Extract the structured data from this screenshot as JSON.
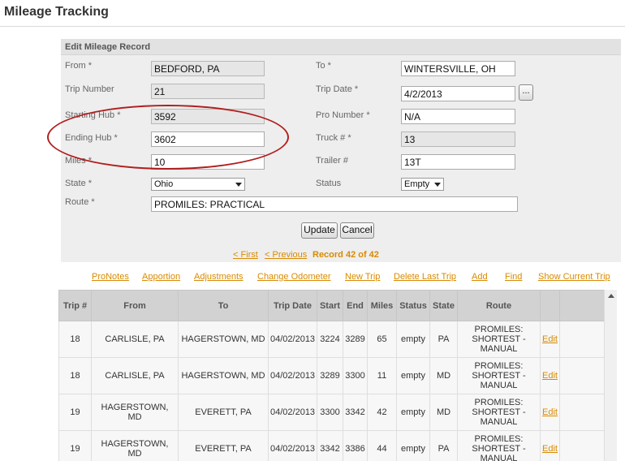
{
  "page": {
    "title": "Mileage Tracking"
  },
  "form": {
    "header": "Edit Mileage Record",
    "from": {
      "label": "From *",
      "value": "BEDFORD, PA"
    },
    "to": {
      "label": "To *",
      "value": "WINTERSVILLE, OH"
    },
    "trip_number": {
      "label": "Trip Number",
      "value": "21"
    },
    "trip_date": {
      "label": "Trip Date *",
      "value": "4/2/2013",
      "picker_label": "..."
    },
    "starting_hub": {
      "label": "Starting Hub *",
      "value": "3592"
    },
    "pro_number": {
      "label": "Pro Number *",
      "value": "N/A"
    },
    "ending_hub": {
      "label": "Ending Hub *",
      "value": "3602"
    },
    "truck": {
      "label": "Truck # *",
      "value": "13"
    },
    "miles": {
      "label": "Miles *",
      "value": "10"
    },
    "trailer": {
      "label": "Trailer #",
      "value": "13T"
    },
    "state": {
      "label": "State *",
      "value": "Ohio"
    },
    "status": {
      "label": "Status",
      "value": "Empty"
    },
    "route": {
      "label": "Route *",
      "value": "PROMILES: PRACTICAL"
    },
    "update_label": "Update",
    "cancel_label": "Cancel"
  },
  "pager": {
    "first": "< First",
    "previous": "< Previous",
    "record": "Record 42 of 42"
  },
  "actions": [
    "ProNotes",
    "Apportion",
    "Adjustments",
    "Change Odometer",
    "New Trip",
    "Delete Last Trip",
    "Add",
    "Find",
    "Show Current Trip"
  ],
  "table": {
    "headers": [
      "Trip #",
      "From",
      "To",
      "Trip Date",
      "Start",
      "End",
      "Miles",
      "Status",
      "State",
      "Route",
      "",
      ""
    ],
    "rows": [
      {
        "trip": "18",
        "from": "CARLISLE, PA",
        "to": "HAGERSTOWN, MD",
        "date": "04/02/2013",
        "start": "3224",
        "end": "3289",
        "miles": "65",
        "status": "empty",
        "state": "PA",
        "route": "PROMILES: SHORTEST - MANUAL",
        "edit": "Edit"
      },
      {
        "trip": "18",
        "from": "CARLISLE, PA",
        "to": "HAGERSTOWN, MD",
        "date": "04/02/2013",
        "start": "3289",
        "end": "3300",
        "miles": "11",
        "status": "empty",
        "state": "MD",
        "route": "PROMILES: SHORTEST - MANUAL",
        "edit": "Edit"
      },
      {
        "trip": "19",
        "from": "HAGERSTOWN, MD",
        "to": "EVERETT, PA",
        "date": "04/02/2013",
        "start": "3300",
        "end": "3342",
        "miles": "42",
        "status": "empty",
        "state": "MD",
        "route": "PROMILES: SHORTEST - MANUAL",
        "edit": "Edit"
      },
      {
        "trip": "19",
        "from": "HAGERSTOWN, MD",
        "to": "EVERETT, PA",
        "date": "04/02/2013",
        "start": "3342",
        "end": "3386",
        "miles": "44",
        "status": "empty",
        "state": "PA",
        "route": "PROMILES: SHORTEST - MANUAL",
        "edit": "Edit"
      }
    ]
  }
}
